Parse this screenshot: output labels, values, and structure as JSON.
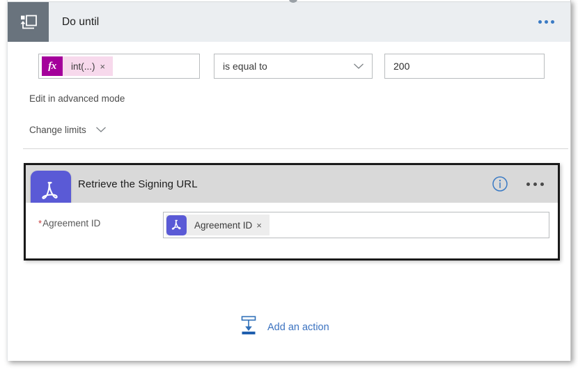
{
  "flow": {
    "loop_action": {
      "icon": "do-until-loop-icon",
      "title": "Do until",
      "overflow_menu": "...",
      "condition": {
        "expression_field": {
          "icon": "fx-icon",
          "icon_label": "fx",
          "token_label": "int(...)",
          "token_remove": "×"
        },
        "operator": {
          "value": "is equal to",
          "chevron": "chevron-down-icon"
        },
        "value": "200"
      },
      "advanced_mode_link": "Edit in advanced mode",
      "change_limits": {
        "label": "Change limits",
        "chevron": "chevron-down-icon"
      }
    },
    "nested_action": {
      "icon": "adobe-sign-icon",
      "title": "Retrieve the Signing URL",
      "info_icon": "info-icon",
      "overflow_menu": "...",
      "fields": [
        {
          "required_marker": "*",
          "label": "Agreement ID",
          "token": {
            "icon": "adobe-sign-icon",
            "label": "Agreement ID",
            "remove": "×"
          }
        }
      ]
    },
    "add_action": {
      "icon": "add-action-arrow-icon",
      "label": "Add an action"
    }
  },
  "colors": {
    "loop_header_bg": "#ebeef1",
    "loop_icon_bg": "#69737d",
    "action_header_bg": "#d9d9d9",
    "adobe_purple": "#5a5ad6",
    "fx_magenta": "#a4009b",
    "token_pink": "#f7d9ec",
    "link_blue": "#3b72c0",
    "info_blue": "#3a7ac4",
    "selected_border": "#1a1a1a",
    "required_red": "#c43b3b"
  }
}
